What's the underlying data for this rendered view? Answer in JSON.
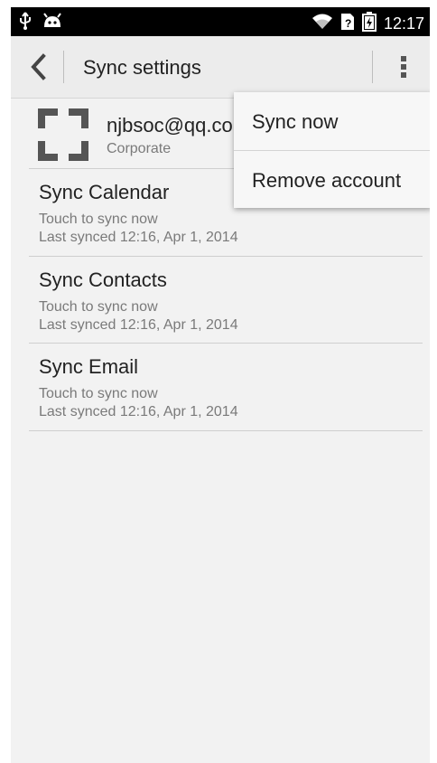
{
  "statusbar": {
    "time": "12:17",
    "icons": [
      "usb-icon",
      "android-icon",
      "wifi-icon",
      "sim-icon",
      "battery-icon"
    ]
  },
  "actionbar": {
    "title": "Sync settings"
  },
  "account": {
    "email": "njbsoc@qq.com",
    "type": "Corporate"
  },
  "sync_items": [
    {
      "title": "Sync Calendar",
      "subtitle": "Touch to sync now",
      "last": "Last synced 12:16, Apr 1, 2014"
    },
    {
      "title": "Sync Contacts",
      "subtitle": "Touch to sync now",
      "last": "Last synced 12:16, Apr 1, 2014"
    },
    {
      "title": "Sync Email",
      "subtitle": "Touch to sync now",
      "last": "Last synced 12:16, Apr 1, 2014"
    }
  ],
  "menu": {
    "items": [
      {
        "label": "Sync now"
      },
      {
        "label": "Remove account"
      }
    ]
  },
  "colors": {
    "background": "#f2f2f2",
    "actionbar": "#ececec",
    "statusbar": "#000000",
    "primary_text": "#222222",
    "secondary_text": "#7a7a7a"
  }
}
